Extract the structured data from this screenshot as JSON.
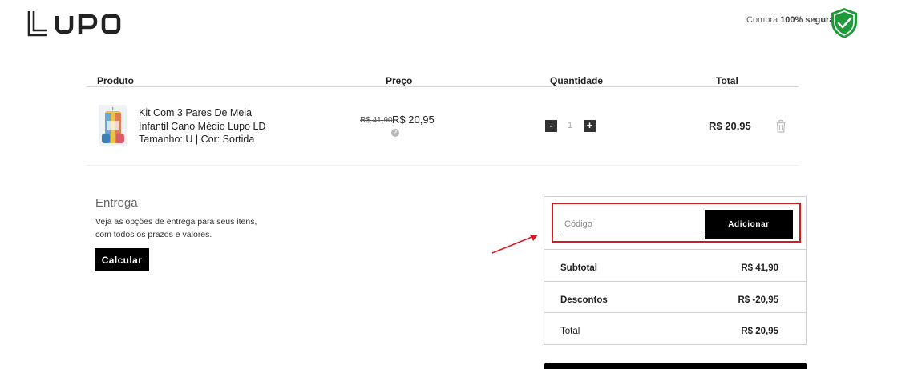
{
  "header": {
    "brand": "LUPO",
    "secure_prefix": "Compra",
    "secure_bold": "100% segura"
  },
  "table": {
    "headers": [
      "Produto",
      "Preço",
      "Quantidade",
      "Total"
    ]
  },
  "product": {
    "name_line1": "Kit Com 3 Pares De Meia",
    "name_line2": "Infantil Cano Médio Lupo LD",
    "name_line3": "Tamanho: U | Cor: Sortida",
    "old_price": "R$ 41,90",
    "price": "R$ 20,95",
    "help": "?",
    "quantity": "1",
    "minus": "-",
    "plus": "+",
    "total": "R$ 20,95"
  },
  "entrega": {
    "title": "Entrega",
    "desc_line1": "Veja as opções de entrega para seus itens,",
    "desc_line2": "com todos os prazos e valores.",
    "button": "Calcular"
  },
  "coupon": {
    "placeholder": "Código",
    "button": "Adicionar"
  },
  "summary": {
    "subtotal_label": "Subtotal",
    "subtotal_value": "R$ 41,90",
    "discount_label": "Descontos",
    "discount_value": "R$ -20,95",
    "total_label": "Total",
    "total_value": "R$ 20,95"
  },
  "colors": {
    "highlight": "#d71920",
    "shield": "#1e9a3a",
    "button": "#000000"
  }
}
